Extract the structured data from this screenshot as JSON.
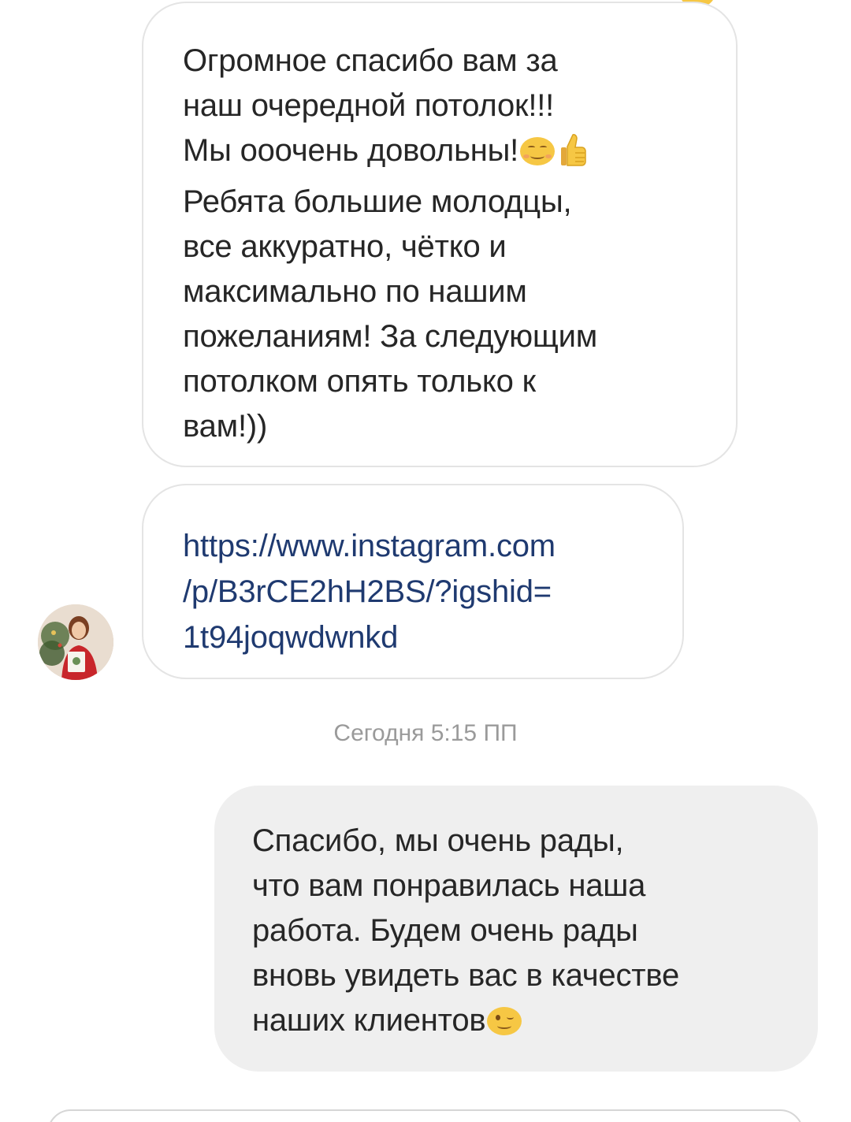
{
  "messages": [
    {
      "type": "incoming",
      "lines": [
        "Огромное спасибо вам за",
        "наш очередной потолок!!!",
        "Мы ооочень довольны!"
      ],
      "emojis_inline": [
        "smiling-face-icon",
        "thumbs-up-icon"
      ],
      "rest": "Ребята большие молодцы,\nвсе аккуратно, чётко и\nмаксимально по нашим\nпожеланиям! За следующим\nпотолком опять только к\nвам!))"
    },
    {
      "type": "incoming-link",
      "link": "https://www.instagram.com\n/p/B3rCE2hH2BS/?igshid=\n1t94joqwdwnkd"
    },
    {
      "type": "outgoing",
      "text": "Спасибо, мы очень рады,\nчто вам понравилась наша\nработа. Будем очень рады\nвновь увидеть вас в качестве\nнаших клиентов",
      "emoji": "winking-face-icon"
    }
  ],
  "timestamp": "Сегодня 5:15 ПП",
  "colors": {
    "incoming_border": "#e4e4e4",
    "outgoing_bg": "#efefef",
    "link": "#1f3a70",
    "timestamp": "#9a9a9a"
  }
}
